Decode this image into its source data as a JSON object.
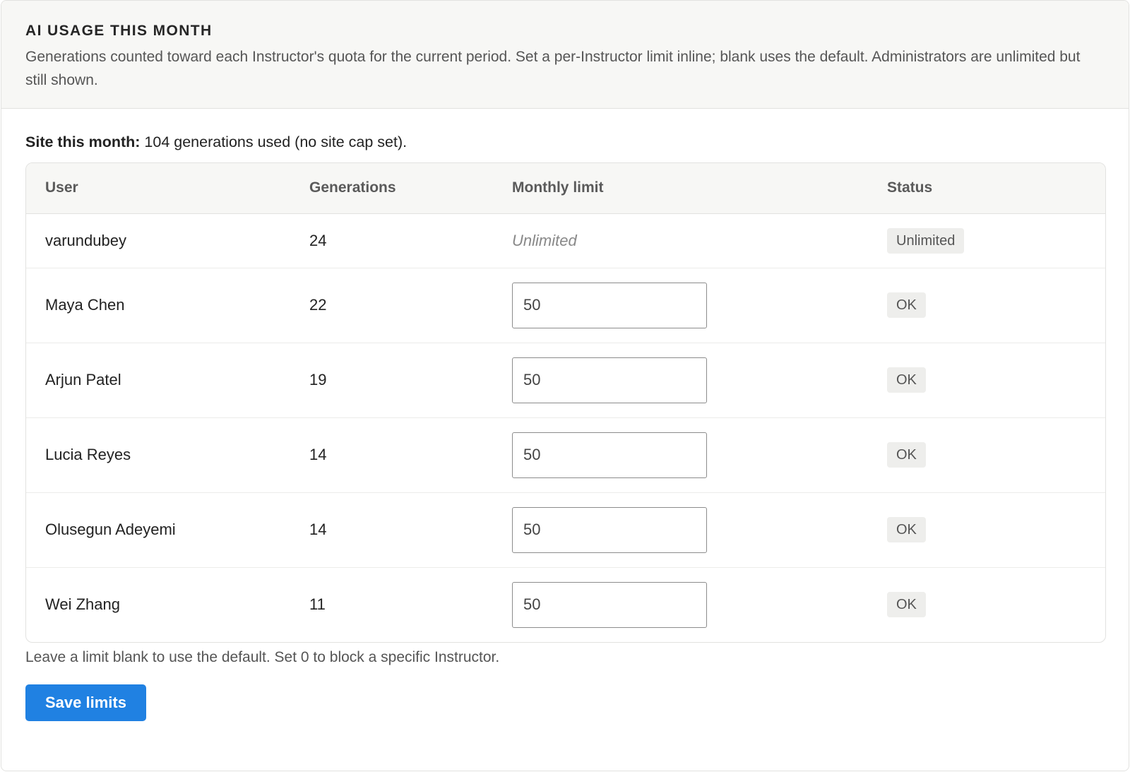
{
  "header": {
    "title": "AI USAGE THIS MONTH",
    "description": "Generations counted toward each Instructor's quota for the current period. Set a per-Instructor limit inline; blank uses the default. Administrators are unlimited but still shown."
  },
  "site_summary": {
    "label": "Site this month:",
    "text": " 104 generations used (no site cap set)."
  },
  "table": {
    "headers": {
      "user": "User",
      "generations": "Generations",
      "monthly_limit": "Monthly limit",
      "status": "Status"
    },
    "rows": [
      {
        "user": "varundubey",
        "generations": "24",
        "limit_text": "Unlimited",
        "status": "Unlimited"
      },
      {
        "user": "Maya Chen",
        "generations": "22",
        "limit_value": "50",
        "status": "OK"
      },
      {
        "user": "Arjun Patel",
        "generations": "19",
        "limit_value": "50",
        "status": "OK"
      },
      {
        "user": "Lucia Reyes",
        "generations": "14",
        "limit_value": "50",
        "status": "OK"
      },
      {
        "user": "Olusegun Adeyemi",
        "generations": "14",
        "limit_value": "50",
        "status": "OK"
      },
      {
        "user": "Wei Zhang",
        "generations": "11",
        "limit_value": "50",
        "status": "OK"
      }
    ]
  },
  "help_text": "Leave a limit blank to use the default. Set 0 to block a specific Instructor.",
  "save_button": "Save limits",
  "colors": {
    "primary_button": "#2081e2",
    "header_background": "#f7f7f5",
    "badge_background": "#eeeeec"
  }
}
